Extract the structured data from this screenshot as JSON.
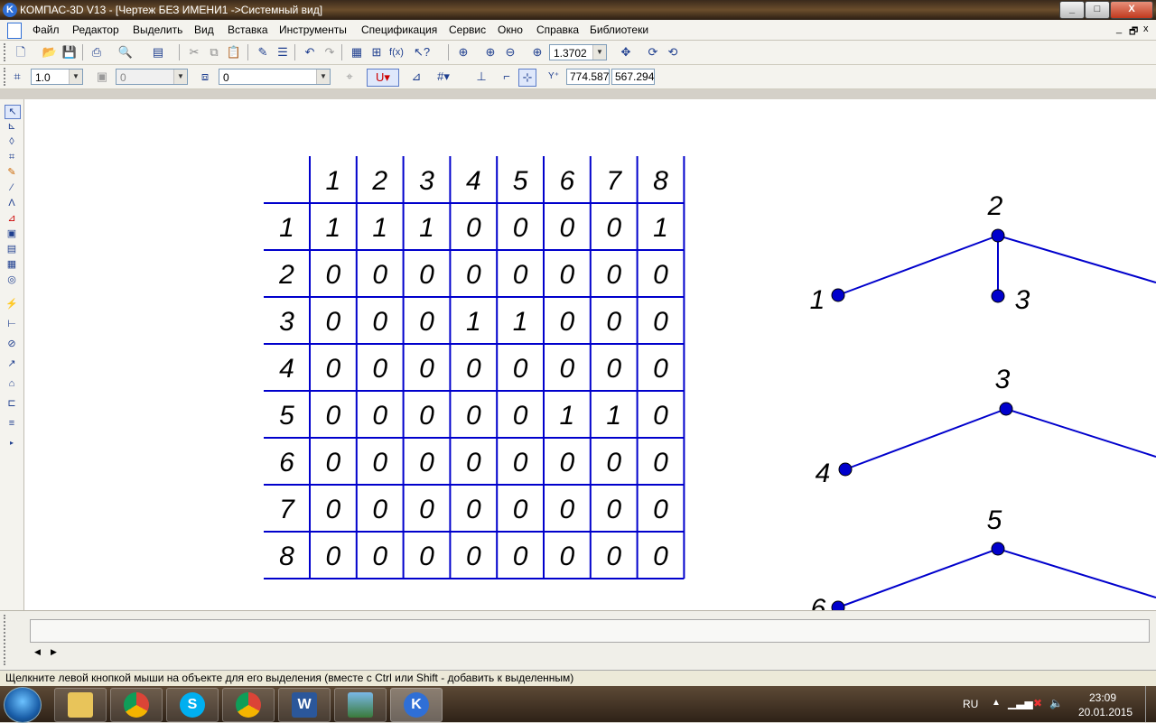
{
  "window": {
    "title": "КОМПАС-3D V13 - [Чертеж БЕЗ ИМЕНИ1 ->Системный вид]",
    "app_icon": "kompas-logo-icon",
    "controls": {
      "minimize": "_",
      "maximize": "□",
      "close": "X"
    },
    "mdi_controls": {
      "minimize": "_",
      "restore": "🗗",
      "close": "x"
    }
  },
  "menu": [
    "Файл",
    "Редактор",
    "Выделить",
    "Вид",
    "Вставка",
    "Инструменты",
    "Спецификация",
    "Сервис",
    "Окно",
    "Справка",
    "Библиотеки"
  ],
  "toolbar1": {
    "zoom_value": "1.3702",
    "icons": [
      "new-document-icon",
      "open-icon",
      "save-icon",
      "print-icon",
      "preview-icon",
      "manager-icon",
      "cut-icon",
      "copy-icon",
      "paste-icon",
      "properties-icon",
      "spec-icon",
      "undo-icon",
      "redo-icon",
      "variables-icon",
      "tree-icon",
      "fx-icon",
      "help-icon",
      "zoom-window-icon",
      "zoom-in-icon",
      "zoom-out-icon",
      "zoom-scale-icon",
      "pan-icon",
      "refresh-icon",
      "redraw-icon"
    ]
  },
  "toolbar2": {
    "step_value": "1.0",
    "style_value": "0",
    "layer_value": "0",
    "coord_x": "774.587",
    "coord_y": "567.294",
    "coord_label": "Y",
    "icons": [
      "cursor-step-icon",
      "style-icon",
      "layer-icon",
      "snap-icon",
      "magnet-icon",
      "ortho-icon",
      "grid-icon",
      "local-cs-icon",
      "round-icon",
      "coordinates-icon"
    ]
  },
  "left_toolbar": [
    "select-icon",
    "geometry-icon",
    "dimensions-icon",
    "symbols-icon",
    "edit-icon",
    "parametrization-icon",
    "measure-icon",
    "selection-icon",
    "associative-views-icon",
    "spec-tool-icon",
    "reports-icon",
    "insert-icon",
    "fragment-icon",
    "line-icon",
    "circle-icon",
    "arc-icon",
    "polygon-icon",
    "hatch-icon",
    "more-icon"
  ],
  "table": {
    "headers": [
      "1",
      "2",
      "3",
      "4",
      "5",
      "6",
      "7",
      "8"
    ],
    "rows": [
      {
        "label": "1",
        "values": [
          "1",
          "1",
          "1",
          "0",
          "0",
          "0",
          "0",
          "1"
        ]
      },
      {
        "label": "2",
        "values": [
          "0",
          "0",
          "0",
          "0",
          "0",
          "0",
          "0",
          "0"
        ]
      },
      {
        "label": "3",
        "values": [
          "0",
          "0",
          "0",
          "1",
          "1",
          "0",
          "0",
          "0"
        ]
      },
      {
        "label": "4",
        "values": [
          "0",
          "0",
          "0",
          "0",
          "0",
          "0",
          "0",
          "0"
        ]
      },
      {
        "label": "5",
        "values": [
          "0",
          "0",
          "0",
          "0",
          "0",
          "1",
          "1",
          "0"
        ]
      },
      {
        "label": "6",
        "values": [
          "0",
          "0",
          "0",
          "0",
          "0",
          "0",
          "0",
          "0"
        ]
      },
      {
        "label": "7",
        "values": [
          "0",
          "0",
          "0",
          "0",
          "0",
          "0",
          "0",
          "0"
        ]
      },
      {
        "label": "8",
        "values": [
          "0",
          "0",
          "0",
          "0",
          "0",
          "0",
          "0",
          "0"
        ]
      }
    ]
  },
  "graph": {
    "labels": [
      "2",
      "1",
      "3",
      "3",
      "4",
      "5",
      "6"
    ]
  },
  "statusbar": {
    "text": "Щелкните левой кнопкой мыши на объекте для его выделения (вместе с Ctrl или Shift - добавить к выделенным)"
  },
  "taskbar": {
    "apps": [
      "explorer-icon",
      "chrome-icon",
      "skype-icon",
      "chrome-icon",
      "word-icon",
      "photo-viewer-icon",
      "kompas-icon"
    ],
    "skype_letter": "S",
    "word_letter": "W",
    "kompas_letter": "K",
    "language": "RU",
    "time": "23:09",
    "date": "20.01.2015"
  },
  "colors": {
    "drawing": "#0000cc",
    "accent": "#2f6fd6"
  }
}
